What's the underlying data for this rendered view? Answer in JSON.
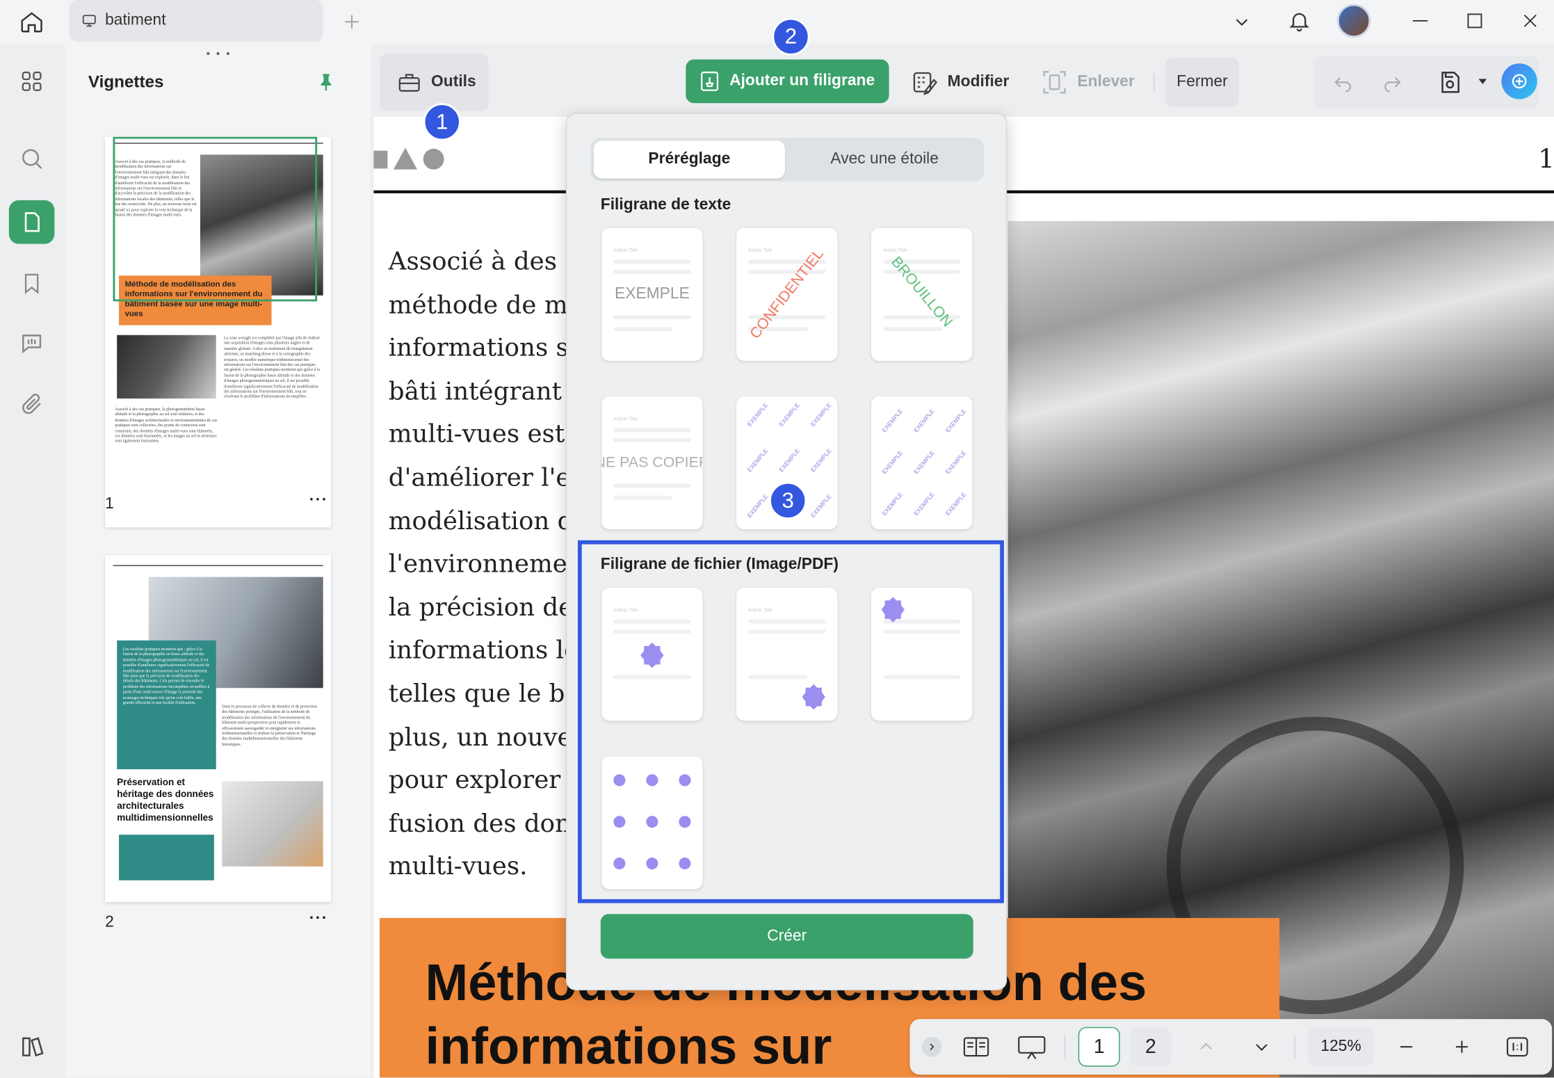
{
  "tab": {
    "title": "batiment"
  },
  "thumbnails": {
    "title": "Vignettes",
    "page1": "1",
    "page2": "2",
    "more": "···"
  },
  "thumb1": {
    "col_text": "Associé à des cas pratiques, la méthode de modélisation des informations sur l'environnement bâti intégrant des données d'images multi-vues est explorée, dans le but d'améliorer l'efficacité de la modélisation des informations sur l'environnement bâti et d'accroître la précision de la modélisation des informations locales des bâtiments, telles que le bas des avant-toits. De plus, un nouveau texte est ajouté ici pour explorer la voie technique de la fusion des données d'images multi-vues.",
    "heading": "Méthode de modélisation des informations sur l'environnement du bâtiment basée sur une image multi-vues",
    "col2": "La zone aveugle est complétée par l'image afin de réaliser une acquisition d'images sous plusieurs angles et de manière globale. Grâce au traitement de triangulation aérienne, au matching dense et à la cartographie des textures, un modèle numérique tridimensionnel des informations sur l'environnement bâti des cas pratiques est généré. Les résultats pratiques montrent que grâce à la fusion de la photographie basse altitude et des données d'images photogrammétriques au sol, il est possible d'améliorer significativement l'efficacité de modélisation des informations sur l'environnement bâti, tout en résolvant le problème d'informations incomplètes.",
    "col3": "Associé à des cas pratiques, la photogrammétrie basse altitude et la photographie au sol sont réalisées, et des données d'images architecturales et environnementales de cas pratiques sont collectées, des points de connexion sont construits, des données d'images multi-vues sont élaborées, ces données sont fusionnées, et les images au sol et aériennes sont également fusionnées."
  },
  "thumb2": {
    "teal_text": "Les résultats pratiques montrent que : grâce à la fusion de la photographie en basse altitude et des données d'images photogrammétriques au sol, il est possible d'améliorer significativement l'efficacité de modélisation des informations sur l'environnement bâti ainsi que la précision de modélisation des détails des bâtiments. Cela permet de résoudre le problème des informations incomplètes recueillies à partir d'une seule source d'image et présente des avantages techniques tels qu'un coût faible, une grande efficacité et une facilité d'utilisation.",
    "heading": "Préservation et héritage des données architecturales multidimensionnelles",
    "col": "Dans le processus de collecte de données et de protection des bâtiments protégés, l'utilisation de la méthode de modélisation des informations de l'environnement du bâtiment multi-perspectives peut rapidement et efficacement sauvegarder et enregistrer ses informations tridimensionnelles et réaliser la préservation et l'héritage des données multidimensionnelles des bâtiments historiques."
  },
  "toolbar": {
    "outils": "Outils",
    "add": "Ajouter un filigrane",
    "modify": "Modifier",
    "remove": "Enlever",
    "close": "Fermer"
  },
  "document": {
    "page_number": "1",
    "lines": [
      "Associé à des c",
      "méthode de mo",
      "informations s",
      "bâti intégrant d",
      "multi-vues est",
      "d'améliorer l'ef",
      "modélisation d",
      "l'environnemen",
      "la précision de",
      "informations lo",
      "telles que le ba",
      "plus, un nouve",
      "pour explorer l",
      "fusion des don",
      "multi-vues."
    ],
    "heading_line1": "Méthode de modélisation des",
    "heading_line2": "informations sur"
  },
  "popup": {
    "tab_preset": "Préréglage",
    "tab_star": "Avec une étoile",
    "text_section": "Filigrane de texte",
    "file_section": "Filigrane de fichier (Image/PDF)",
    "create": "Créer",
    "card_title": "Article Title",
    "wm_example": "EXEMPLE",
    "wm_confidential": "CONFIDENTIEL",
    "wm_draft": "BROUILLON",
    "wm_nocopy": "NE PAS COPIER"
  },
  "badges": {
    "b1": "1",
    "b2": "2",
    "b3": "3"
  },
  "bottombar": {
    "page1": "1",
    "page2": "2",
    "zoom": "125%"
  },
  "colors": {
    "green": "#3aa16a",
    "orange": "#f08a3c",
    "teal": "#2f8b86",
    "blue": "#3457e0",
    "purple": "#9a8ef0"
  }
}
